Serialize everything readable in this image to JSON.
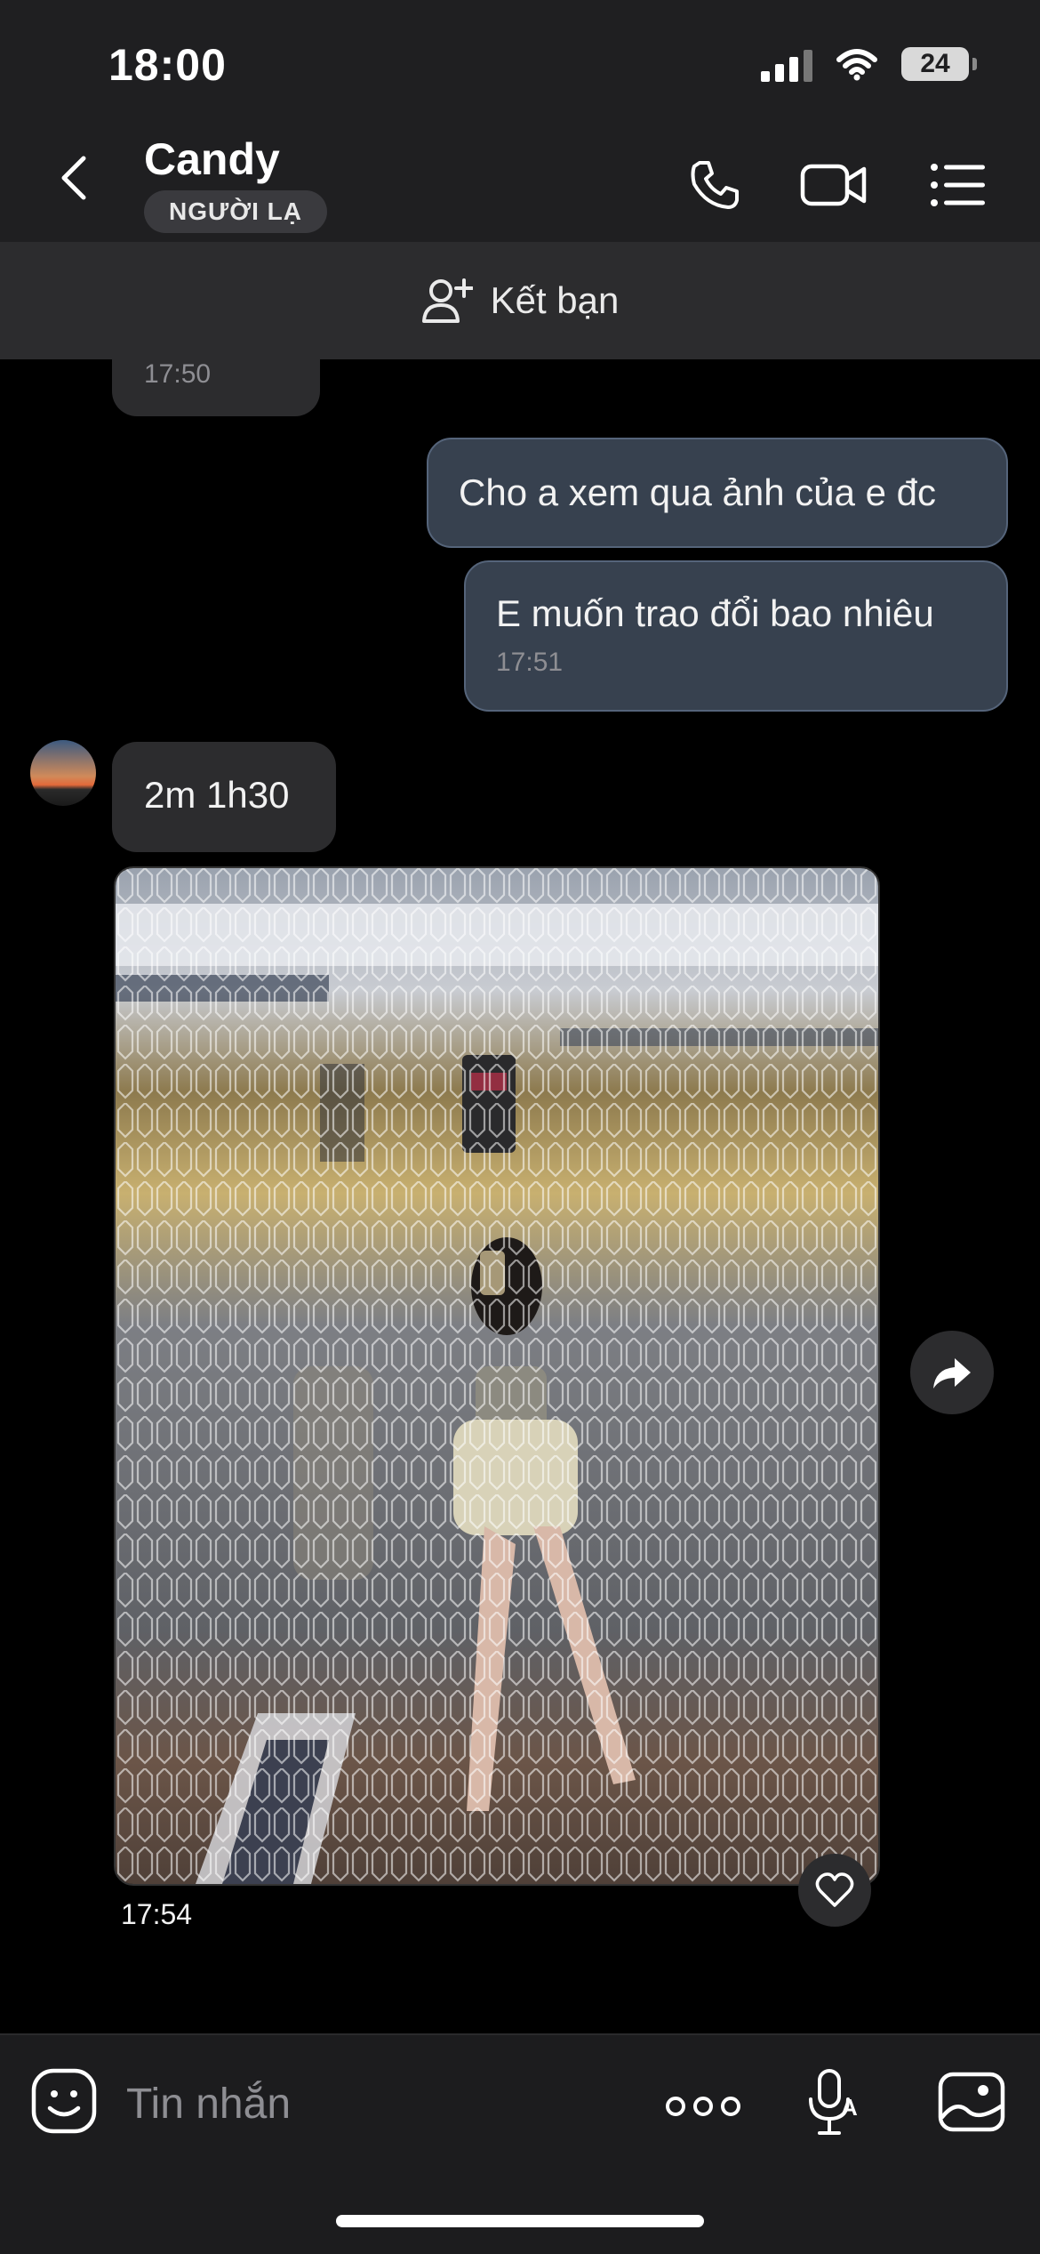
{
  "status_bar": {
    "time": "18:00",
    "battery": "24"
  },
  "header": {
    "contact_name": "Candy",
    "badge": "NGƯỜI LẠ",
    "icons": [
      "back-icon",
      "phone-icon",
      "video-camera-icon",
      "menu-icon"
    ]
  },
  "friend_bar": {
    "label": "Kết bạn",
    "icon": "add-person-icon"
  },
  "messages": [
    {
      "direction": "incoming",
      "text": "",
      "time": "17:50"
    },
    {
      "direction": "outgoing",
      "text": "Cho a xem qua ảnh của e đc",
      "time": ""
    },
    {
      "direction": "outgoing",
      "text": "E muốn trao đổi bao nhiêu",
      "time": "17:51"
    },
    {
      "direction": "incoming",
      "text": "2m 1h30",
      "time": ""
    },
    {
      "direction": "incoming",
      "type": "photo",
      "time": "17:54"
    }
  ],
  "composer": {
    "placeholder": "Tin nhắn",
    "icons": [
      "sticker-icon",
      "more-icon",
      "voice-icon",
      "image-icon"
    ]
  },
  "colors": {
    "background": "#000000",
    "header": "#1f1f21",
    "incoming_bubble": "#2c2c2e",
    "outgoing_bubble": "#37414f"
  }
}
